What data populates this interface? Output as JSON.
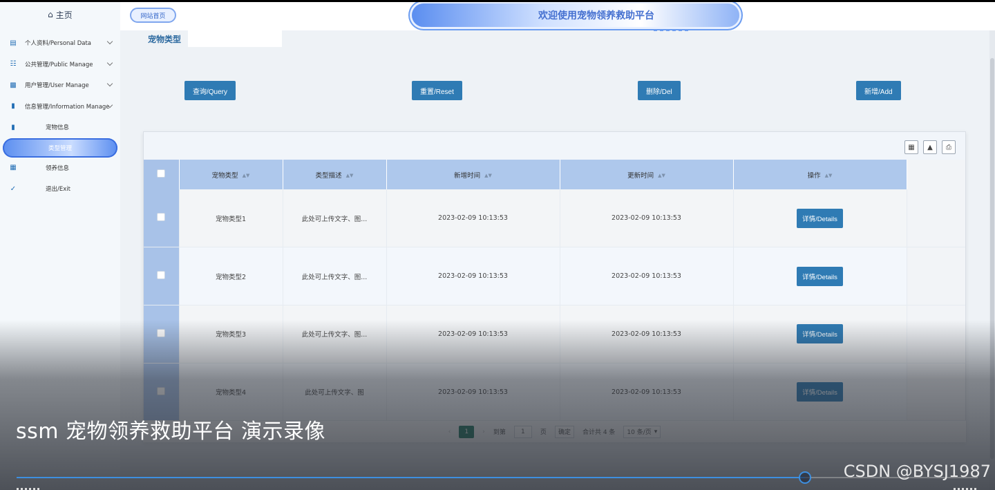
{
  "sidebar": {
    "home": "主页",
    "items": [
      {
        "label": "个人资料/Personal Data",
        "icon": "document-icon",
        "expandable": true
      },
      {
        "label": "公共管理/Public Manage",
        "icon": "clipboard-icon",
        "expandable": true
      },
      {
        "label": "用户管理/User Manage",
        "icon": "bar-chart-icon",
        "expandable": true
      },
      {
        "label": "信息管理/Information Manage",
        "icon": "stats-icon",
        "expandable": true
      },
      {
        "label": "宠物信息",
        "icon": "bookmark-icon",
        "expandable": false
      },
      {
        "label": "类型管理",
        "icon": "",
        "expandable": false,
        "active": true
      },
      {
        "label": "领养信息",
        "icon": "calendar-icon",
        "expandable": false
      },
      {
        "label": "退出/Exit",
        "icon": "calendar-check-icon",
        "expandable": false
      }
    ]
  },
  "topbar": {
    "site_button": "网站首页",
    "banner_title": "欢迎使用宠物领养救助平台"
  },
  "tabs": [
    "宠物类型"
  ],
  "toolbar": {
    "query": "查询/Query",
    "reset": "重置/Reset",
    "delete": "删除/Del",
    "add": "新增/Add"
  },
  "table": {
    "columns": [
      "宠物类型",
      "类型描述",
      "新增时间",
      "更新时间",
      "操作"
    ],
    "rows": [
      {
        "type": "宠物类型1",
        "desc": "此处可上传文字、图...",
        "created": "2023-02-09 10:13:53",
        "updated": "2023-02-09 10:13:53",
        "action": "详情/Details"
      },
      {
        "type": "宠物类型2",
        "desc": "此处可上传文字、图...",
        "created": "2023-02-09 10:13:53",
        "updated": "2023-02-09 10:13:53",
        "action": "详情/Details"
      },
      {
        "type": "宠物类型3",
        "desc": "此处可上传文字、图...",
        "created": "2023-02-09 10:13:53",
        "updated": "2023-02-09 10:13:53",
        "action": "详情/Details"
      },
      {
        "type": "宠物类型4",
        "desc": "此处可上传文字、图",
        "created": "2023-02-09 10:13:53",
        "updated": "2023-02-09 10:13:53",
        "action": "详情/Details"
      }
    ]
  },
  "pagination": {
    "current": "1",
    "goto_label": "到第",
    "page_input": "1",
    "page_unit": "页",
    "confirm": "确定",
    "total": "合计共 4 条",
    "page_size": "10 条/页"
  },
  "video": {
    "caption": "ssm 宠物领养救助平台 演示录像",
    "watermark": "CSDN @BYSJ1987",
    "progress": 0.79
  }
}
